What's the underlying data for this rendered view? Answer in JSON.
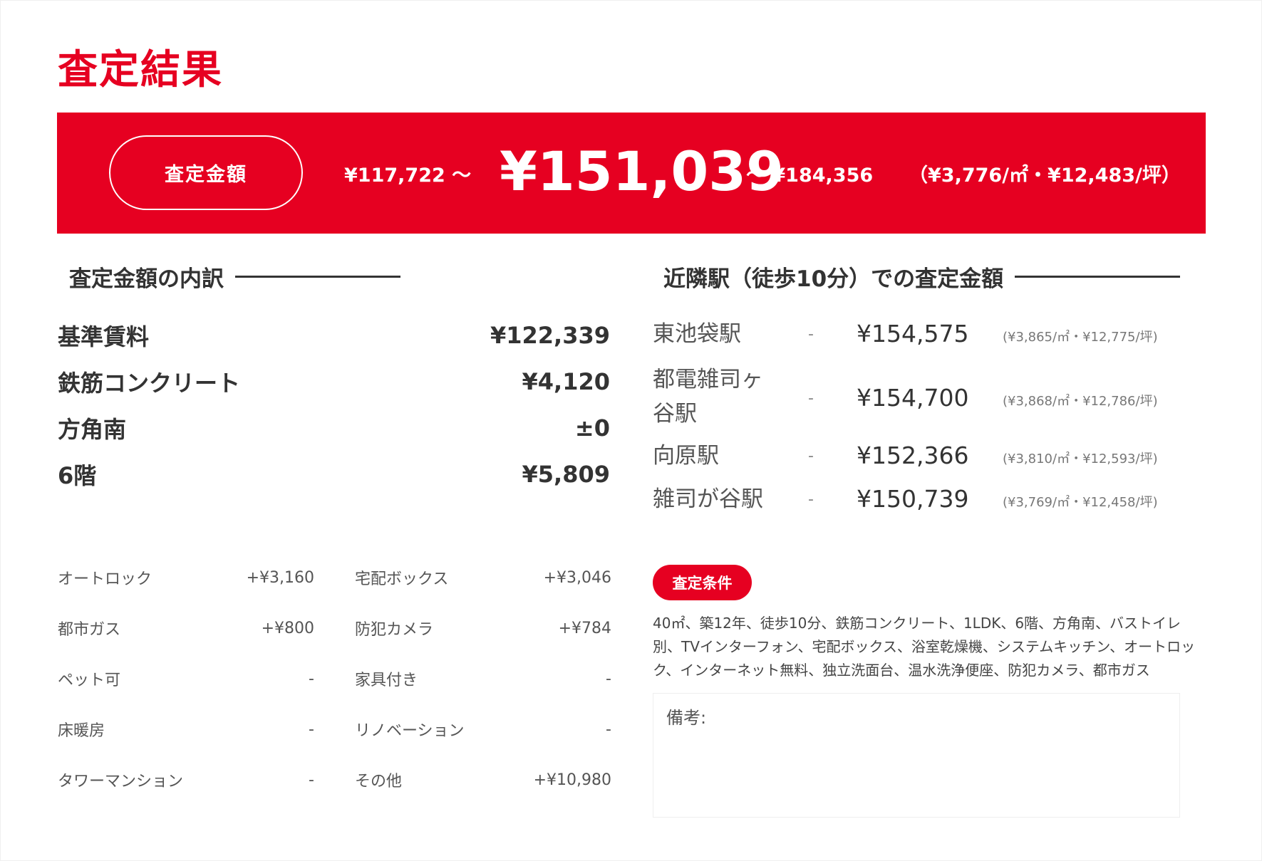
{
  "title": "査定結果",
  "banner": {
    "label": "査定金額",
    "range_low": "¥117,722 ～",
    "price": "¥151,039",
    "range_high": "～ ¥184,356",
    "unit_price": "（¥3,776/㎡・¥12,483/坪）"
  },
  "breakdown": {
    "heading": "査定金額の内訳",
    "rows": [
      {
        "label": "基準賃料",
        "value": "¥122,339"
      },
      {
        "label": "鉄筋コンクリート",
        "value": "¥4,120"
      },
      {
        "label": "方角南",
        "value": "±0"
      },
      {
        "label": "6階",
        "value": "¥5,809"
      }
    ],
    "features": [
      {
        "label": "オートロック",
        "value": "+¥3,160"
      },
      {
        "label": "宅配ボックス",
        "value": "+¥3,046"
      },
      {
        "label": "都市ガス",
        "value": "+¥800"
      },
      {
        "label": "防犯カメラ",
        "value": "+¥784"
      },
      {
        "label": "ペット可",
        "value": "-"
      },
      {
        "label": "家具付き",
        "value": "-"
      },
      {
        "label": "床暖房",
        "value": "-"
      },
      {
        "label": "リノベーション",
        "value": "-"
      },
      {
        "label": "タワーマンション",
        "value": "-"
      },
      {
        "label": "その他",
        "value": "+¥10,980"
      }
    ]
  },
  "stations": {
    "heading": "近隣駅（徒歩10分）での査定金額",
    "rows": [
      {
        "name": "東池袋駅",
        "dash": "-",
        "price": "¥154,575",
        "sub": "(¥3,865/㎡・¥12,775/坪)"
      },
      {
        "name": "都電雑司ヶ谷駅",
        "dash": "-",
        "price": "¥154,700",
        "sub": "(¥3,868/㎡・¥12,786/坪)"
      },
      {
        "name": "向原駅",
        "dash": "-",
        "price": "¥152,366",
        "sub": "(¥3,810/㎡・¥12,593/坪)"
      },
      {
        "name": "雑司が谷駅",
        "dash": "-",
        "price": "¥150,739",
        "sub": "(¥3,769/㎡・¥12,458/坪)"
      }
    ]
  },
  "conditions": {
    "badge": "査定条件",
    "text": "40㎡、築12年、徒歩10分、鉄筋コンクリート、1LDK、6階、方角南、バストイレ別、TVインターフォン、宅配ボックス、浴室乾燥機、システムキッチン、オートロック、インターネット無料、独立洗面台、温水洗浄便座、防犯カメラ、都市ガス"
  },
  "notes": {
    "label": "備考:"
  },
  "colors": {
    "accent": "#e60021"
  }
}
